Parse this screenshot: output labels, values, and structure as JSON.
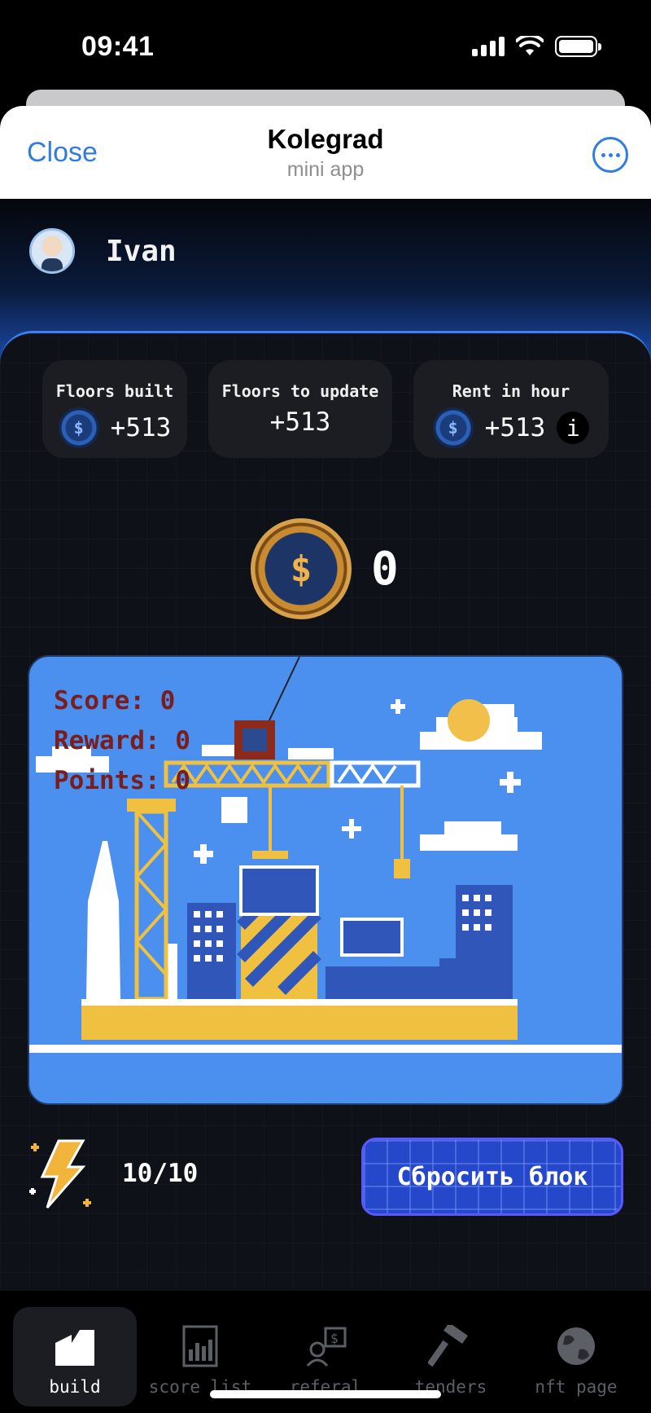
{
  "status_bar": {
    "time": "09:41"
  },
  "header": {
    "close_label": "Close",
    "title": "Kolegrad",
    "subtitle": "mini app"
  },
  "user": {
    "name": "Ivan"
  },
  "stats": [
    {
      "title": "Floors built",
      "value": "+513",
      "icon": "coin-icon"
    },
    {
      "title": "Floors to update",
      "value": "+513"
    },
    {
      "title": "Rent in hour",
      "value": "+513",
      "icon": "coin-icon",
      "info": "i"
    }
  ],
  "balance": {
    "value": "0",
    "icon": "coin-icon"
  },
  "game": {
    "score_line": "Score: 0",
    "reward_line": "Reward: 0",
    "points_line": "Points: 0"
  },
  "energy": {
    "value": "10/10",
    "icon": "lightning-icon"
  },
  "reset_button": {
    "label": "Сбросить блок"
  },
  "tabs": [
    {
      "label": "build",
      "icon": "building-icon",
      "active": true
    },
    {
      "label": "score list",
      "icon": "chart-icon",
      "active": false
    },
    {
      "label": "referal",
      "icon": "referral-icon",
      "active": false
    },
    {
      "label": "tenders",
      "icon": "hammer-icon",
      "active": false
    },
    {
      "label": "nft page",
      "icon": "globe-icon",
      "active": false
    }
  ],
  "colors": {
    "accent": "#2f7de1",
    "sky": "#4b90ee",
    "button": "#2547c9",
    "score_text": "#7a1d1d"
  }
}
